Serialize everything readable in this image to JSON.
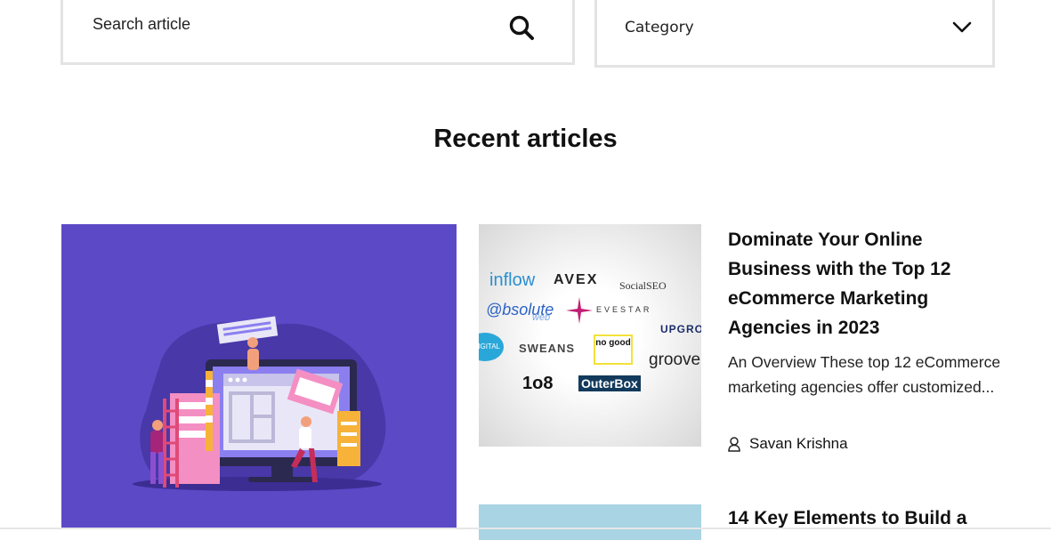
{
  "search": {
    "placeholder": "Search article"
  },
  "category": {
    "label": "Category"
  },
  "section": {
    "title": "Recent articles"
  },
  "articles": [
    {
      "title": "Dominate Your Online Business with the Top 12 eCommerce Marketing Agencies in 2023",
      "excerpt": "An Overview These top 12 eCommerce marketing agencies offer customized...",
      "author": "Savan Krishna",
      "thumb_logos": [
        "inflow",
        "AVEX",
        "SocialSEO",
        "@bsolute",
        "web",
        "EVESTAR",
        "UPGRO",
        "DIGITAL",
        "SWEANS",
        "no good",
        "groove",
        "1o8",
        "OuterBox"
      ]
    },
    {
      "title": "14 Key Elements to Build a"
    }
  ],
  "colors": {
    "hero_bg": "#5b49c6",
    "thumb2_bg": "#a9d4e4",
    "border": "#e3e3e3"
  },
  "icons": {
    "search": "search-icon",
    "dropdown": "chevron-down-icon",
    "author": "user-icon"
  }
}
